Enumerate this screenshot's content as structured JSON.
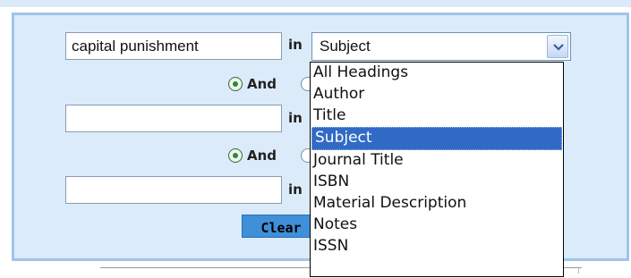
{
  "search": {
    "rows": [
      {
        "value": "capital punishment",
        "in_label": "in"
      },
      {
        "value": "",
        "in_label": "in"
      },
      {
        "value": "",
        "in_label": "in"
      }
    ],
    "operators": [
      {
        "label": "And",
        "checked": true
      },
      {
        "label": "And",
        "checked": true
      }
    ],
    "field_select": {
      "selected": "Subject",
      "options": [
        "All Headings",
        "Author",
        "Title",
        "Subject",
        "Journal Title",
        "ISBN",
        "Material Description",
        "Notes",
        "ISSN"
      ]
    },
    "clear_label": "Clear"
  },
  "colors": {
    "panel_bg": "#dcebfa",
    "panel_border": "#9fc4ec",
    "highlight": "#316ac5",
    "radio_dot": "#2c8a2c",
    "clear_button": "#3f8fd9"
  },
  "icons": [
    "chevron-down-icon",
    "radio-icon"
  ]
}
